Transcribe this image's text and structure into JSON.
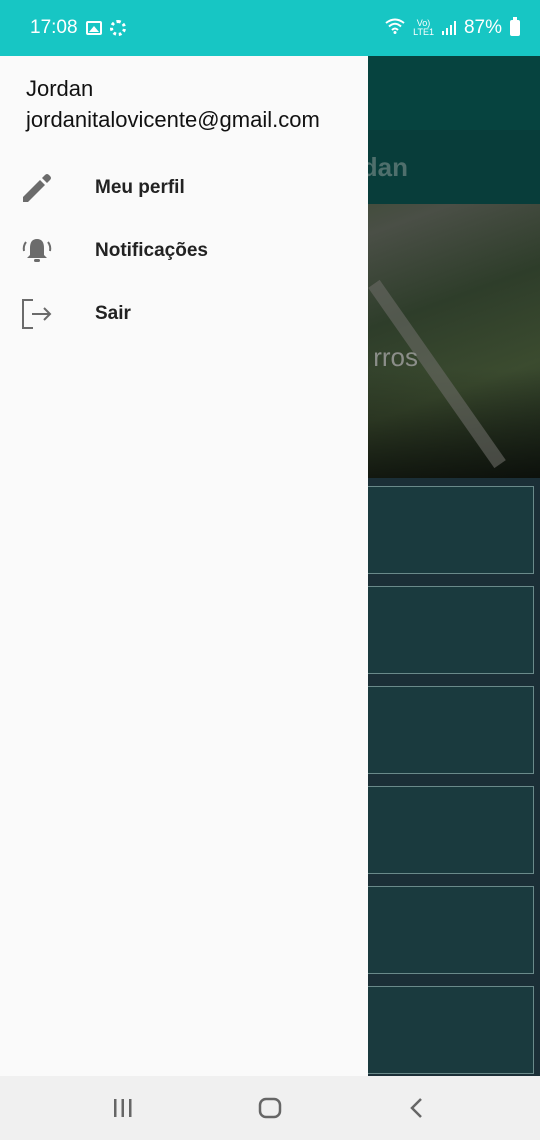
{
  "status_bar": {
    "time": "17:08",
    "battery": "87%",
    "network": "LTE1",
    "volte": "Vo)"
  },
  "background": {
    "subheader_text": "dan",
    "banner_text": "rros"
  },
  "drawer": {
    "user_name": "Jordan",
    "user_email": "jordanitalovicente@gmail.com",
    "items": [
      {
        "label": "Meu perfil",
        "icon": "pencil-icon"
      },
      {
        "label": "Notificações",
        "icon": "bell-icon"
      },
      {
        "label": "Sair",
        "icon": "logout-icon"
      }
    ]
  },
  "nav": {
    "recents_icon": "recents-icon",
    "home_icon": "home-icon",
    "back_icon": "back-icon"
  },
  "colors": {
    "status_bar": "#17c6c4",
    "drawer_bg": "#fafafa",
    "app_toolbar": "#06433f",
    "icon_gray": "#6b6b6b"
  }
}
